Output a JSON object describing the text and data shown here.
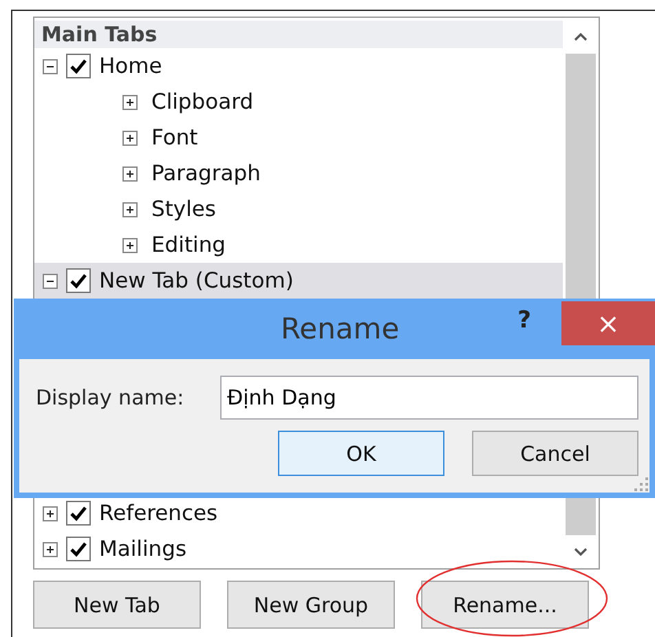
{
  "tree": {
    "header": "Main Tabs",
    "items": [
      {
        "label": "Home",
        "checked": true,
        "expanded": true,
        "selected": false,
        "children": [
          {
            "label": "Clipboard",
            "expanded": false
          },
          {
            "label": "Font",
            "expanded": false
          },
          {
            "label": "Paragraph",
            "expanded": false
          },
          {
            "label": "Styles",
            "expanded": false
          },
          {
            "label": "Editing",
            "expanded": false
          }
        ]
      },
      {
        "label": "New Tab (Custom)",
        "checked": true,
        "expanded": true,
        "selected": true
      },
      {
        "label": "References",
        "checked": true,
        "expanded": false,
        "selected": false
      },
      {
        "label": "Mailings",
        "checked": true,
        "expanded": false,
        "selected": false
      }
    ]
  },
  "buttons": [
    {
      "label": "New Tab"
    },
    {
      "label": "New Group"
    },
    {
      "label": "Rename..."
    }
  ],
  "dialog": {
    "title": "Rename",
    "help": "?",
    "close": "×",
    "field_label": "Display name:",
    "value": "Định Dạng",
    "buttons": [
      {
        "label": "OK",
        "default": true
      },
      {
        "label": "Cancel",
        "default": false
      }
    ]
  }
}
